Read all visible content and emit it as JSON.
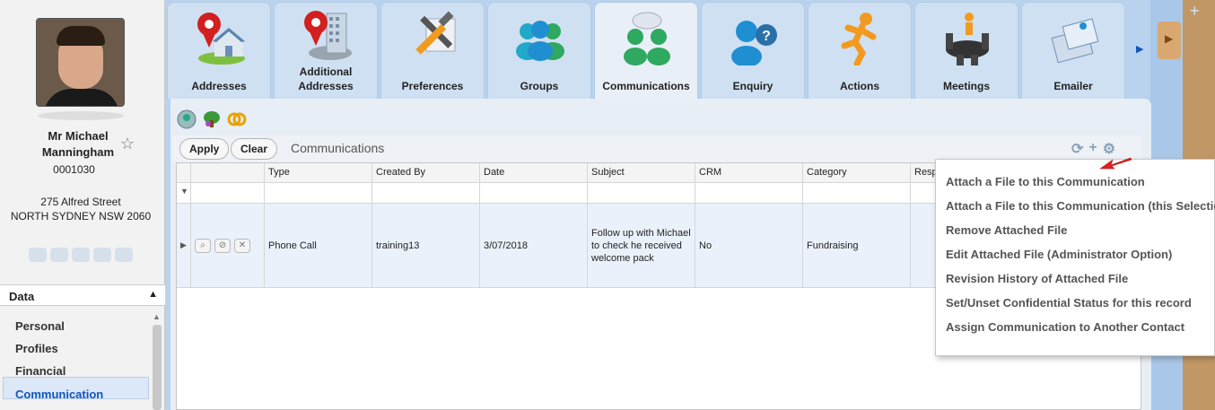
{
  "contact": {
    "name": "Mr Michael Manningham",
    "name_line1": "Mr Michael",
    "name_line2": "Manningham",
    "id": "0001030",
    "address_line1": "275 Alfred Street",
    "address_line2": "NORTH SYDNEY NSW 2060"
  },
  "sidebar": {
    "section_title": "Data",
    "items": [
      {
        "label": "Personal"
      },
      {
        "label": "Profiles"
      },
      {
        "label": "Financial"
      },
      {
        "label": "Communication",
        "active": true
      }
    ]
  },
  "tabs": [
    {
      "label": "Addresses",
      "icon": "house-pin-icon"
    },
    {
      "label": "Additional Addresses",
      "icon": "building-pin-icon"
    },
    {
      "label": "Preferences",
      "icon": "tools-icon"
    },
    {
      "label": "Groups",
      "icon": "people-group-icon"
    },
    {
      "label": "Communications",
      "icon": "people-talk-icon",
      "active": true
    },
    {
      "label": "Enquiry",
      "icon": "person-question-icon"
    },
    {
      "label": "Actions",
      "icon": "running-man-icon"
    },
    {
      "label": "Meetings",
      "icon": "meeting-table-icon"
    },
    {
      "label": "Emailer",
      "icon": "envelope-icon"
    }
  ],
  "toolbar": {
    "apply_label": "Apply",
    "clear_label": "Clear",
    "title": "Communications"
  },
  "grid": {
    "columns": [
      "Type",
      "Created By",
      "Date",
      "Subject",
      "CRM",
      "Category",
      "Resp"
    ],
    "rows": [
      {
        "type": "Phone Call",
        "created_by": "training13",
        "date": "3/07/2018",
        "subject": "Follow up with Michael to check he received welcome pack",
        "crm": "No",
        "category": "Fundraising"
      }
    ]
  },
  "context_menu": {
    "items": [
      "Attach a File to this Communication",
      "Attach a File to this Communication (this Selection)",
      "Remove Attached File",
      "Edit Attached File (Administrator Option)",
      "Revision History of Attached File",
      "Set/Unset Confidential Status for this record",
      "Assign Communication to Another Contact"
    ]
  },
  "colors": {
    "accent_blue": "#1155bb",
    "tab_background": "#cfe0f2",
    "arrow_red": "#e02020"
  }
}
